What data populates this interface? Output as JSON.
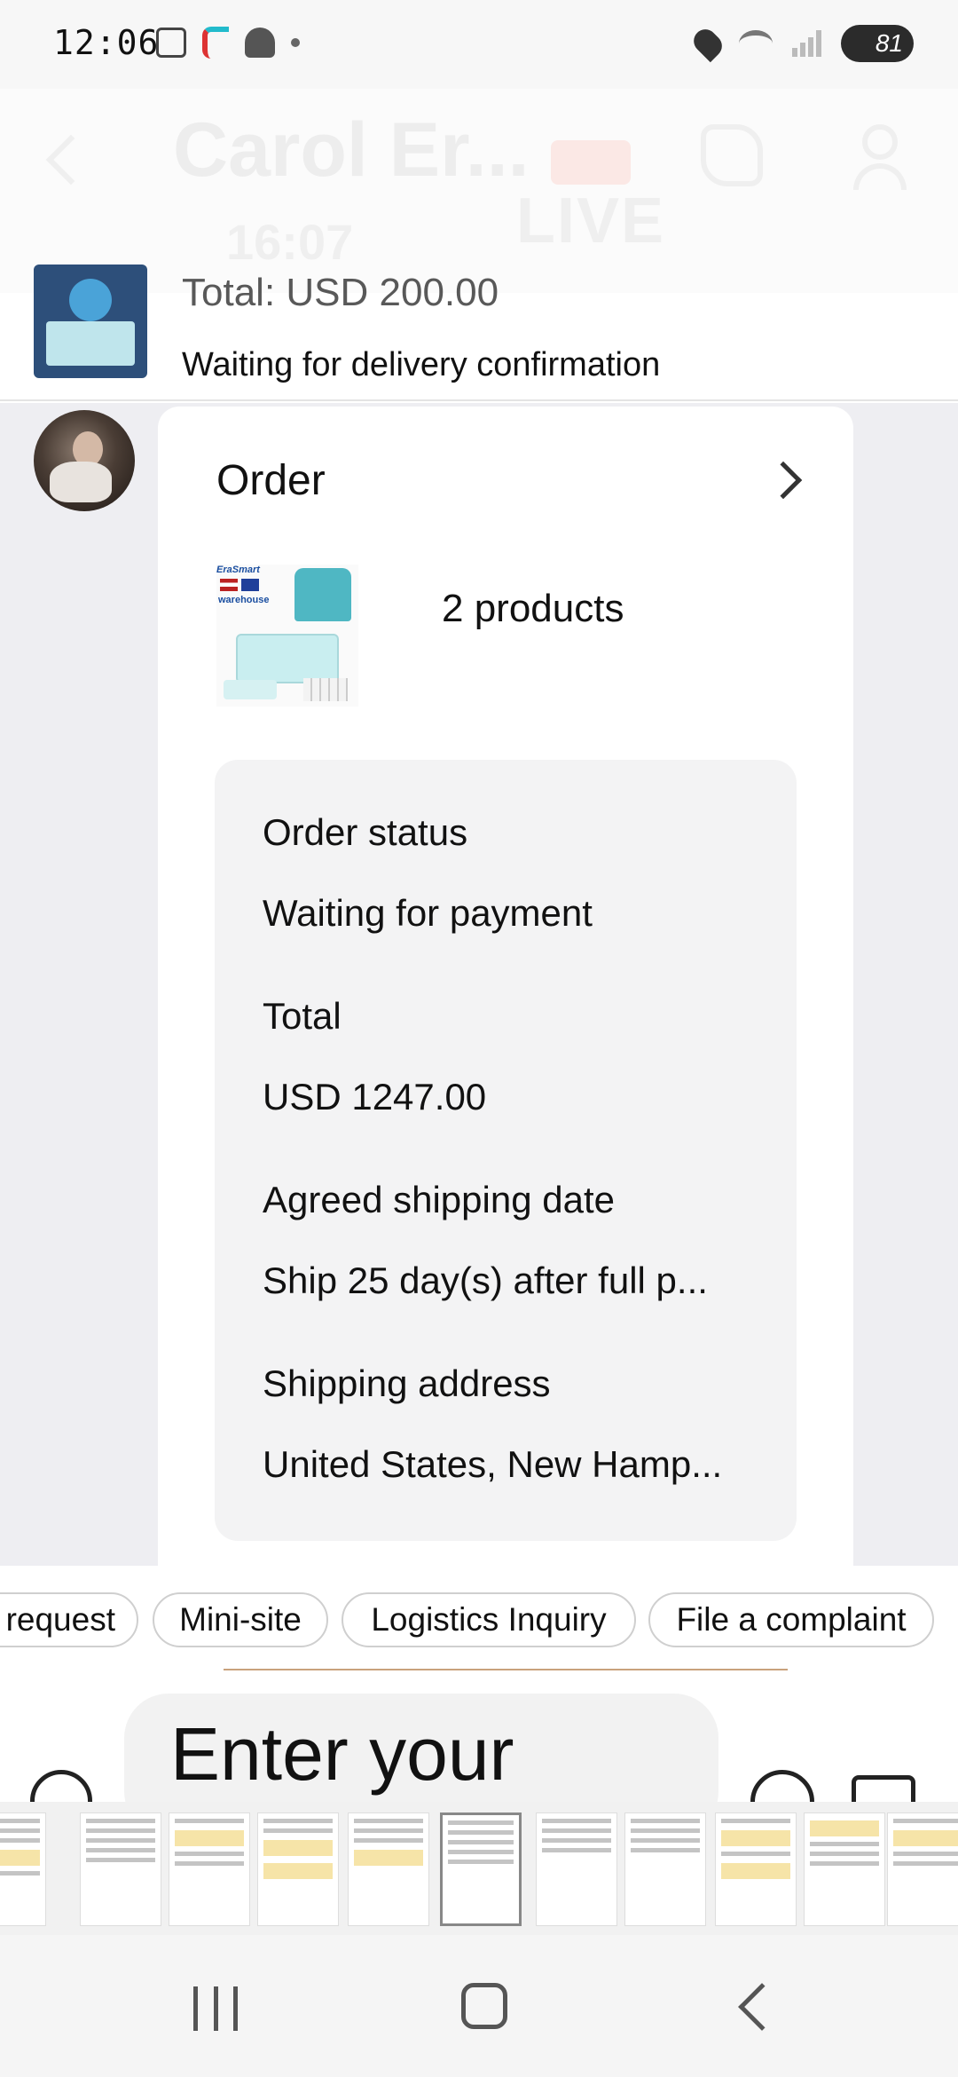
{
  "status_bar": {
    "time": "12:06",
    "battery": "81",
    "icons": [
      "gallery-icon",
      "tiktok-icon",
      "snapchat-icon",
      "dot-icon",
      "location-icon",
      "wifi-icon",
      "signal-icon",
      "battery-icon"
    ]
  },
  "header": {
    "title": "Carol Er...",
    "subtitle": "16:07",
    "live_label": "LIVE"
  },
  "previous_order": {
    "total": "Total: USD 200.00",
    "status": "Waiting for delivery confirmation"
  },
  "order_card": {
    "title": "Order",
    "products_count": "2 products",
    "image_tag": "EraSmart",
    "image_warehouse": "warehouse",
    "rows": [
      {
        "label": "Order status",
        "value": "Waiting for payment"
      },
      {
        "label": "Total",
        "value": "USD 1247.00"
      },
      {
        "label": "Agreed shipping date",
        "value": "Ship 25 day(s) after full p..."
      },
      {
        "label": "Shipping address",
        "value": "United States, New Hamp..."
      }
    ]
  },
  "quick_actions": [
    "request",
    "Mini-site",
    "Logistics Inquiry",
    "File a complaint"
  ],
  "input": {
    "placeholder": "Enter your"
  },
  "colors": {
    "chat_background": "#eeeef2",
    "card_background": "#ffffff",
    "info_box": "#f3f3f4",
    "accent_line": "#c9a27c"
  }
}
